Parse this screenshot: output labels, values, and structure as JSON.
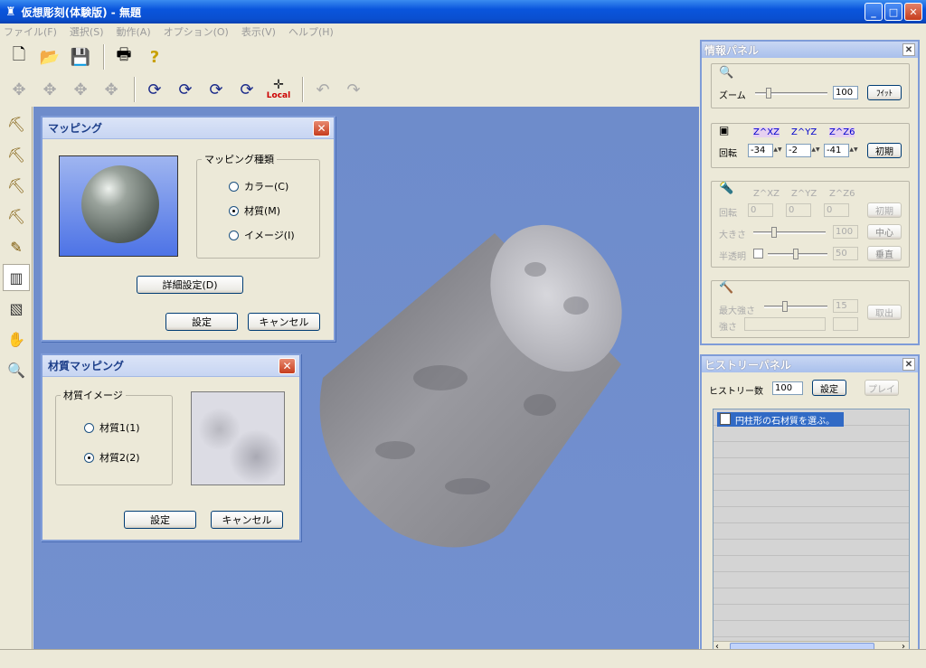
{
  "window": {
    "title": "仮想彫刻(体験版) - 無題"
  },
  "menu": [
    "ファイル(F)",
    "選択(S)",
    "動作(A)",
    "オプション(O)",
    "表示(V)",
    "ヘルプ(H)"
  ],
  "toolbar": {
    "local_label": "Local"
  },
  "mapping_dialog": {
    "title": "マッピング",
    "group_label": "マッピング種類",
    "options": [
      "カラー(C)",
      "材質(M)",
      "イメージ(I)"
    ],
    "selected": 1,
    "detail_button": "詳細設定(D)",
    "ok_button": "設定",
    "cancel_button": "キャンセル"
  },
  "material_dialog": {
    "title": "材質マッピング",
    "group_label": "材質イメージ",
    "options": [
      "材質1(1)",
      "材質2(2)"
    ],
    "selected": 1,
    "ok_button": "設定",
    "cancel_button": "キャンセル"
  },
  "info_panel": {
    "title": "情報パネル",
    "zoom_label": "ズーム",
    "zoom_value": "100",
    "fit_button": "ﾌｲｯﾄ",
    "rot_headers": [
      "Z^XZ",
      "Z^YZ",
      "Z^Z6"
    ],
    "rotation_label": "回転",
    "rotation_values": [
      "-34",
      "-2",
      "-41"
    ],
    "reset_button": "初期",
    "light_headers": [
      "Z^XZ",
      "Z^YZ",
      "Z^Z6"
    ],
    "light_rotation_values": [
      "0",
      "0",
      "0"
    ],
    "light_reset_button": "初期",
    "size_label": "大きさ",
    "size_value": "100",
    "center_button": "中心",
    "transparency_label": "半透明",
    "transparency_value": "50",
    "vertical_button": "垂直",
    "max_strength_label": "最大強さ",
    "max_strength_value": "15",
    "strength_label": "強さ",
    "pick_button": "取出"
  },
  "history_panel": {
    "title": "ヒストリーパネル",
    "count_label": "ヒストリー数",
    "count_value": "100",
    "set_button": "設定",
    "play_button": "プレイ",
    "items": [
      "円柱形の石材質を選ぶ。"
    ]
  },
  "colors": {
    "viewport": "#7390cf",
    "accent": "#0a55dc",
    "selection": "#316ac5"
  }
}
